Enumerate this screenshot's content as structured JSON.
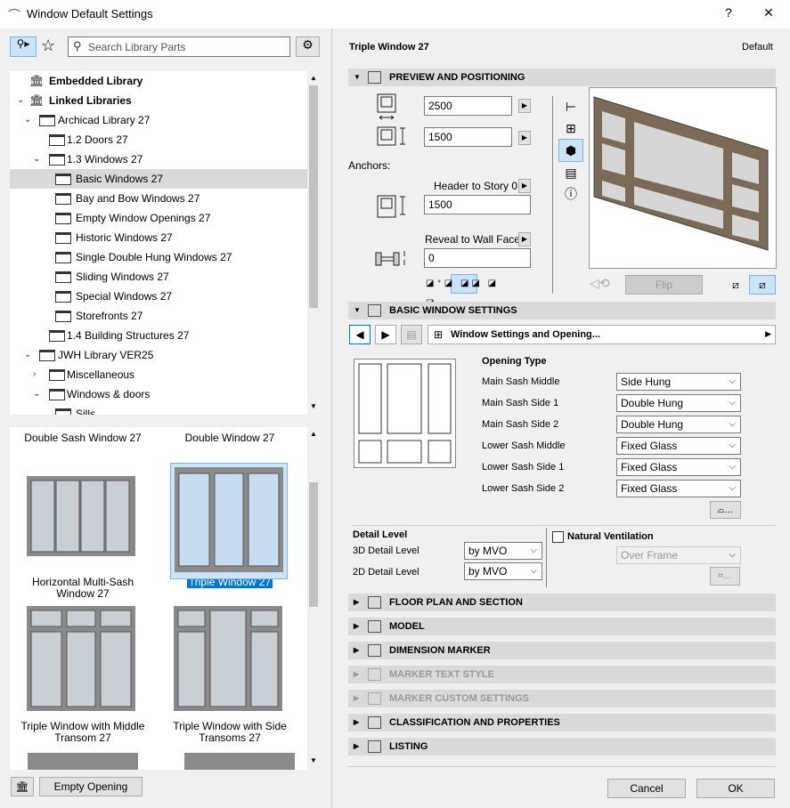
{
  "window": {
    "title": "Window Default Settings",
    "help": "?",
    "close": "✕"
  },
  "left": {
    "search_placeholder": "Search Library Parts",
    "tree": [
      {
        "label": "Embedded Library",
        "level": 0,
        "bold": true,
        "icon": "library-icon"
      },
      {
        "label": "Linked Libraries",
        "level": 0,
        "bold": true,
        "icon": "library-icon",
        "expanded": true
      },
      {
        "label": "Archicad Library 27",
        "level": 1,
        "expanded": true
      },
      {
        "label": "1.2 Doors 27",
        "level": 2
      },
      {
        "label": "1.3 Windows 27",
        "level": 2,
        "expanded": true
      },
      {
        "label": "Basic Windows 27",
        "level": 3,
        "selected": true
      },
      {
        "label": "Bay and Bow Windows 27",
        "level": 3
      },
      {
        "label": "Empty Window Openings 27",
        "level": 3
      },
      {
        "label": "Historic Windows 27",
        "level": 3
      },
      {
        "label": "Single Double Hung Windows 27",
        "level": 3
      },
      {
        "label": "Sliding Windows 27",
        "level": 3
      },
      {
        "label": "Special Windows 27",
        "level": 3
      },
      {
        "label": "Storefronts 27",
        "level": 3
      },
      {
        "label": "1.4 Building Structures 27",
        "level": 2
      },
      {
        "label": "JWH Library VER25",
        "level": 1,
        "expanded": true
      },
      {
        "label": "Miscellaneous",
        "level": 2,
        "collapsed": true
      },
      {
        "label": "Windows & doors",
        "level": 2,
        "expanded": true
      },
      {
        "label": "Sills",
        "level": 3
      }
    ],
    "gallery": [
      {
        "name": "Double Sash Window 27"
      },
      {
        "name": "Double Window 27"
      },
      {
        "name": "Horizontal Multi-Sash Window 27"
      },
      {
        "name": "Triple Window 27",
        "selected": true
      },
      {
        "name": "Triple Window with Middle Transom 27"
      },
      {
        "name": "Triple Window with Side Transoms 27"
      }
    ],
    "empty_opening": "Empty Opening"
  },
  "right": {
    "title": "Triple Window 27",
    "default_label": "Default",
    "sections": {
      "preview": "PREVIEW AND POSITIONING",
      "basic": "BASIC WINDOW SETTINGS",
      "floor": "FLOOR PLAN AND SECTION",
      "model": "MODEL",
      "dimension": "DIMENSION MARKER",
      "marker_text": "MARKER TEXT STYLE",
      "marker_custom": "MARKER CUSTOM SETTINGS",
      "classification": "CLASSIFICATION AND PROPERTIES",
      "listing": "LISTING"
    },
    "width": "2500",
    "height": "1500",
    "anchors": "Anchors:",
    "header_to_story": "Header to Story 0",
    "header_value": "1500",
    "reveal": "Reveal to Wall Face",
    "reveal_value": "0",
    "flip": "Flip",
    "page_nav": "Window Settings and Opening...",
    "opening_type": "Opening Type",
    "sashes": [
      {
        "label": "Main Sash Middle",
        "value": "Side Hung"
      },
      {
        "label": "Main Sash Side 1",
        "value": "Double Hung"
      },
      {
        "label": "Main Sash Side 2",
        "value": "Double Hung"
      },
      {
        "label": "Lower Sash Middle",
        "value": "Fixed Glass"
      },
      {
        "label": "Lower Sash Side 1",
        "value": "Fixed Glass"
      },
      {
        "label": "Lower Sash Side 2",
        "value": "Fixed Glass"
      }
    ],
    "detail_level": "Detail Level",
    "detail3d_label": "3D Detail Level",
    "detail3d": "by MVO",
    "detail2d_label": "2D Detail Level",
    "detail2d": "by MVO",
    "natural_ventilation": "Natural Ventilation",
    "natural_ventilation_checked": false,
    "ventilation_type": "Over Frame",
    "cancel": "Cancel",
    "ok": "OK"
  },
  "colors": {
    "accent": "#0078d7",
    "section_bg": "#dadada",
    "frame": "#7b6a58",
    "glass": "#d8d8d8"
  }
}
